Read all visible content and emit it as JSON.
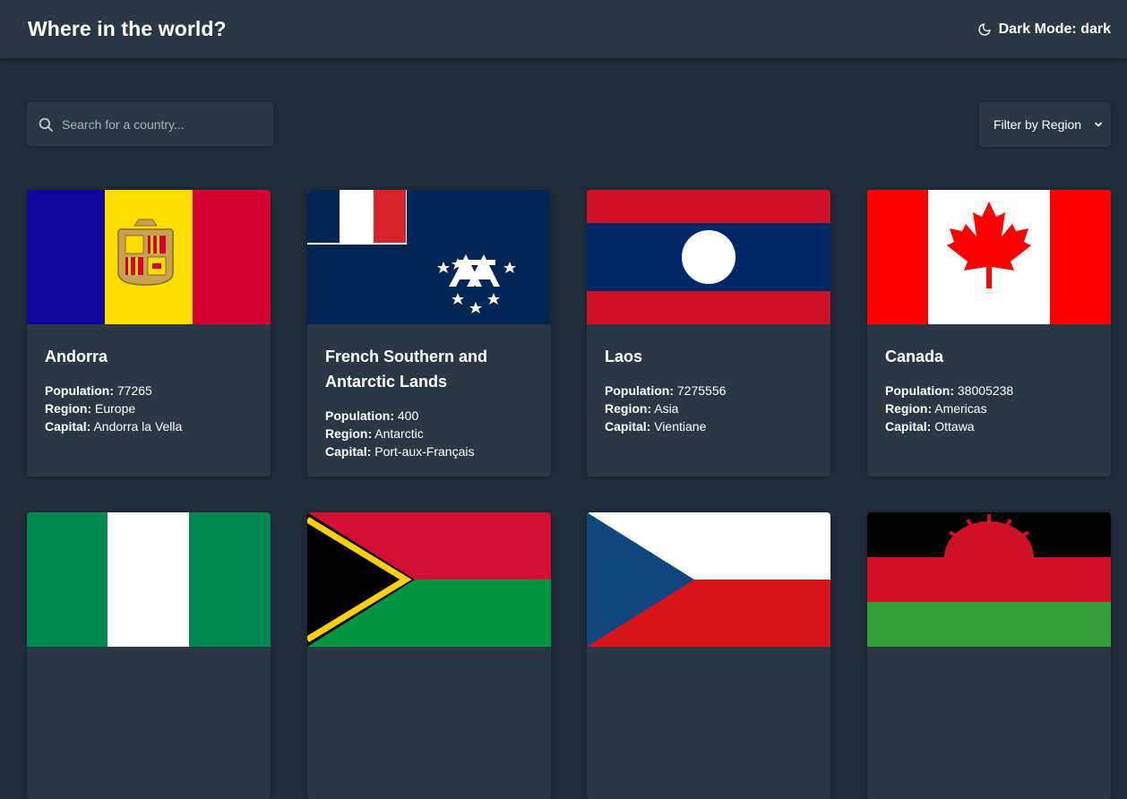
{
  "header": {
    "title": "Where in the world?",
    "mode_label": "Dark Mode: dark",
    "mode_icon": "moon-icon"
  },
  "search": {
    "placeholder": "Search for a country...",
    "icon": "search-icon"
  },
  "filter": {
    "label": "Filter by Region",
    "icon": "chevron-down-icon"
  },
  "labels": {
    "population": "Population:",
    "region": "Region:",
    "capital": "Capital:"
  },
  "countries": [
    {
      "name": "Andorra",
      "population": "77265",
      "region": "Europe",
      "capital": "Andorra la Vella"
    },
    {
      "name": "French Southern and Antarctic Lands",
      "population": "400",
      "region": "Antarctic",
      "capital": "Port-aux-Français"
    },
    {
      "name": "Laos",
      "population": "7275556",
      "region": "Asia",
      "capital": "Vientiane"
    },
    {
      "name": "Canada",
      "population": "38005238",
      "region": "Americas",
      "capital": "Ottawa"
    }
  ],
  "colors": {
    "background": "#202c37",
    "surface": "#2b3743",
    "text": "#ffffff"
  }
}
